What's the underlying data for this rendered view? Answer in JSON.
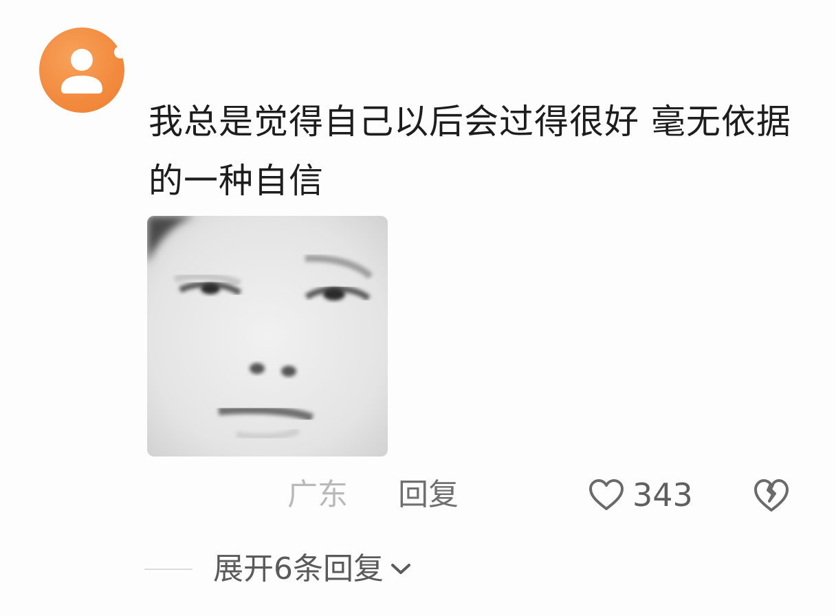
{
  "comment": {
    "text": "我总是觉得自己以后会过得很好 毫无依据的一种自信",
    "location": "广东",
    "reply_label": "回复",
    "like_count": "343",
    "expand_label": "展开6条回复"
  },
  "icons": {
    "avatar": "default-user-avatar",
    "like": "heart-outline-icon",
    "dislike": "broken-heart-icon",
    "expand": "chevron-down-icon"
  },
  "colors": {
    "avatar_bg": "#f28a3e",
    "text_primary": "#1d1d1d",
    "text_muted": "#b9b9b9",
    "text_secondary": "#6f6f6f"
  }
}
